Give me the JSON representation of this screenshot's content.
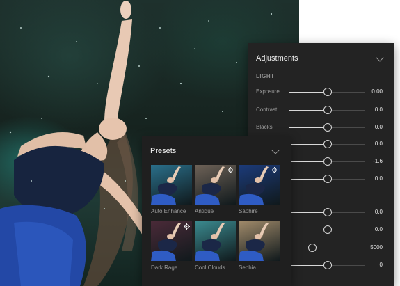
{
  "adjustments": {
    "title": "Adjustments",
    "section_light": "LIGHT",
    "rows": [
      {
        "label": "Exposure",
        "value": "0.00",
        "level": 0.5
      },
      {
        "label": "Contrast",
        "value": "0.0",
        "level": 0.5
      },
      {
        "label": "Blacks",
        "value": "0.0",
        "level": 0.5
      },
      {
        "label": "",
        "value": "0.0",
        "level": 0.5
      },
      {
        "label": "",
        "value": "-1.6",
        "level": 0.5
      },
      {
        "label": "",
        "value": "0.0",
        "level": 0.5
      },
      {
        "label": "",
        "value": "0.0",
        "level": 0.5
      },
      {
        "label": "",
        "value": "0.0",
        "level": 0.5
      },
      {
        "label": "",
        "value": "5000",
        "level": 0.3
      },
      {
        "label": "",
        "value": "0",
        "level": 0.5
      }
    ]
  },
  "presets": {
    "title": "Presets",
    "items": [
      {
        "label": "Auto Enhance",
        "tint": "#2a6f8a"
      },
      {
        "label": "Antique",
        "tint": "#6e6257"
      },
      {
        "label": "Saphire",
        "tint": "#1c3b7a"
      },
      {
        "label": "Dark Rage",
        "tint": "#4a2a38"
      },
      {
        "label": "Cool Clouds",
        "tint": "#3b8a8f"
      },
      {
        "label": "Sephia",
        "tint": "#a08a6a"
      }
    ]
  },
  "icons": {
    "collapse": "chevron-down-icon",
    "preset_settings": "gear-icon"
  }
}
